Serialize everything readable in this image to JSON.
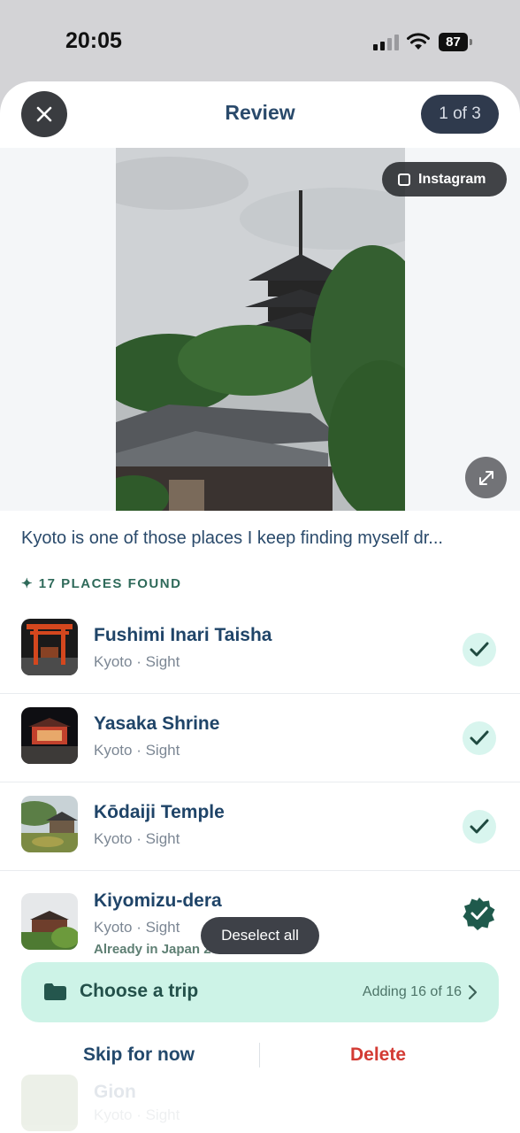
{
  "status": {
    "time": "20:05",
    "battery": "87"
  },
  "header": {
    "title": "Review",
    "counter": "1 of 3"
  },
  "media": {
    "source_label": "Instagram"
  },
  "caption": "Kyoto is one of those places I keep finding myself dr...",
  "found_label": "✦ 17 PLACES FOUND",
  "places": [
    {
      "name": "Fushimi Inari Taisha",
      "meta": "Kyoto · Sight",
      "selected": true
    },
    {
      "name": "Yasaka Shrine",
      "meta": "Kyoto · Sight",
      "selected": true
    },
    {
      "name": "Kōdaiji Temple",
      "meta": "Kyoto · Sight",
      "selected": true
    },
    {
      "name": "Kiyomizu-dera",
      "meta": "Kyoto · Sight",
      "note": "Already in Japan 2026",
      "selected": true
    }
  ],
  "ghost_place": {
    "name": "Gion",
    "meta": "Kyoto · Sight"
  },
  "deselect_label": "Deselect all",
  "trip": {
    "label": "Choose a trip",
    "status": "Adding 16 of 16"
  },
  "actions": {
    "skip": "Skip for now",
    "delete": "Delete"
  },
  "colors": {
    "accent_mint": "#cdf3e7",
    "check_bg": "#d8f5ee",
    "check_icon": "#1f4a40",
    "delete": "#d33b34"
  }
}
